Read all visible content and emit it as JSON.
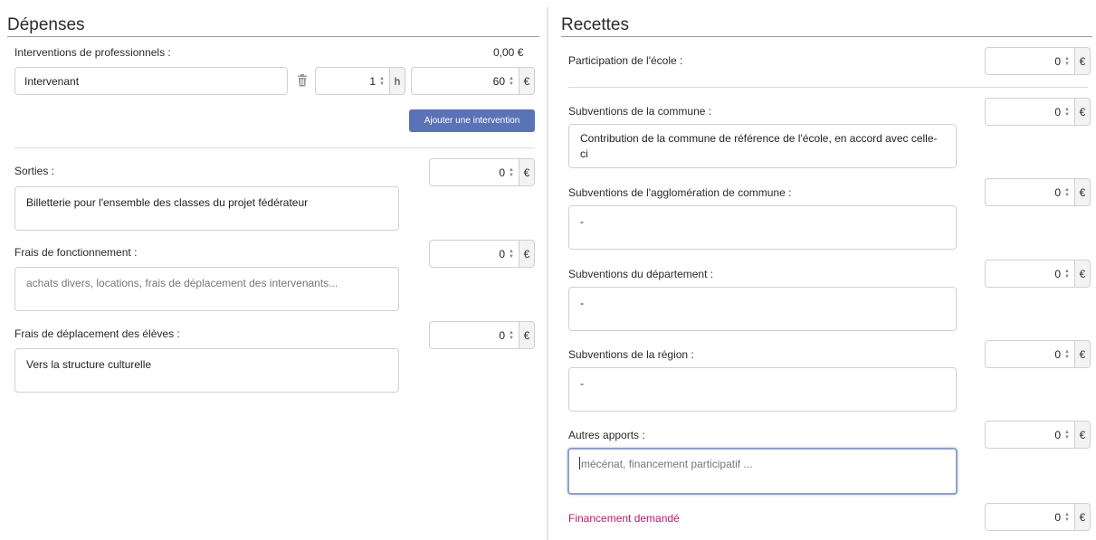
{
  "depenses": {
    "title": "Dépenses",
    "interventions": {
      "label": "Interventions de professionnels :",
      "total": "0,00 €",
      "intervenant_value": "Intervenant",
      "hours_value": "1",
      "hours_unit": "h",
      "rate_value": "60",
      "rate_unit": "€",
      "add_button": "Ajouter une intervention"
    },
    "sorties": {
      "label": "Sorties :",
      "amount": "0",
      "unit": "€",
      "text": "Billetterie pour l'ensemble des classes du projet fédérateur"
    },
    "fonctionnement": {
      "label": "Frais de fonctionnement :",
      "amount": "0",
      "unit": "€",
      "placeholder": "achats divers, locations, frais de déplacement des intervenants..."
    },
    "deplacement": {
      "label": "Frais de déplacement des élèves :",
      "amount": "0",
      "unit": "€",
      "text": "Vers la structure culturelle"
    }
  },
  "recettes": {
    "title": "Recettes",
    "ecole": {
      "label": "Participation de l'école :",
      "amount": "0",
      "unit": "€"
    },
    "commune": {
      "label": "Subventions de la commune :",
      "amount": "0",
      "unit": "€",
      "text": "Contribution de la commune de référence de l'école, en accord avec celle-ci"
    },
    "agglomeration": {
      "label": "Subventions de l'agglomération de commune :",
      "amount": "0",
      "unit": "€",
      "text": "-"
    },
    "departement": {
      "label": "Subventions du département :",
      "amount": "0",
      "unit": "€",
      "text": "-"
    },
    "region": {
      "label": "Subventions de la région :",
      "amount": "0",
      "unit": "€",
      "text": "-"
    },
    "autres": {
      "label": "Autres apports :",
      "amount": "0",
      "unit": "€",
      "placeholder": "mécénat, financement participatif ..."
    },
    "financement": {
      "label": "Financement demandé",
      "amount": "0",
      "unit": "€"
    }
  },
  "colors": {
    "accent_button": "#5a72b6",
    "highlight_label": "#c2186e",
    "focus_border": "#8ea2c9"
  },
  "icons": {
    "trash": "trash-icon",
    "spinner": "spinner-arrows-icon"
  }
}
